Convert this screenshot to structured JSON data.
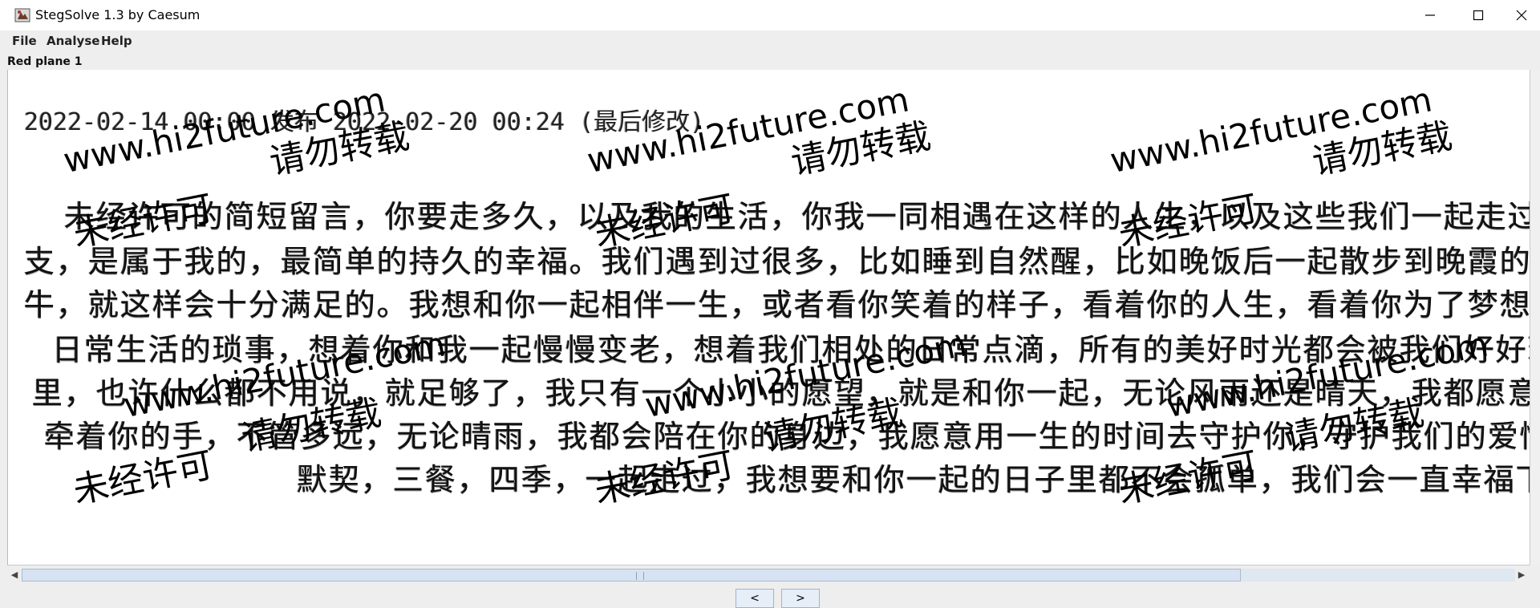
{
  "window": {
    "title": "StegSolve 1.3 by Caesum",
    "minimize_glyph": "─",
    "maximize_glyph": "☐",
    "close_glyph": "✕"
  },
  "menu": {
    "items": [
      "File",
      "Analyse",
      "Help"
    ]
  },
  "plane_label": "Red plane 1",
  "image": {
    "header_text": "2022-02-14 00:00 发布 2022-02-20 00:24 (最后修改)",
    "body_lines": [
      "未经许可的简短留言，你要走多久，以及我的生活，你我一同相遇在这样的人生，以及这些我们一起走过的日子里",
      "支，是属于我的，最简单的持久的幸福。我们遇到过很多，比如睡到自然醒，比如晚饭后一起散步到晚霞的尽头",
      "牛，就这样会十分满足的。我想和你一起相伴一生，或者看你笑着的样子，看着你的人生，看着你为了梦想而奋斗",
      "日常生活的琐事，想着你和我一起慢慢变老，想着我们相处的日常点滴，所有的美好时光都会被我们好好珍藏",
      "里，也许什么都不用说，就足够了，我只有一个小小的愿望，就是和你一起，无论风雨还是晴天，我都愿意陪着你",
      "牵着你的手，不管多远，无论晴雨，我都会陪在你的身边，我愿意用一生的时间去守护你，守护我们的爱情",
      "默契，三餐，四季，一起走过，我想要和你一起的日子里都不会孤单，我们会一直幸福下去，永远在一起"
    ],
    "watermark_url": "www.hi2future.com",
    "watermark_text1": "请勿转载",
    "watermark_text2": "未经许可"
  },
  "nav": {
    "prev_label": "<",
    "next_label": ">"
  },
  "scrollbar": {
    "left_arrow": "◀",
    "right_arrow": "▶"
  }
}
